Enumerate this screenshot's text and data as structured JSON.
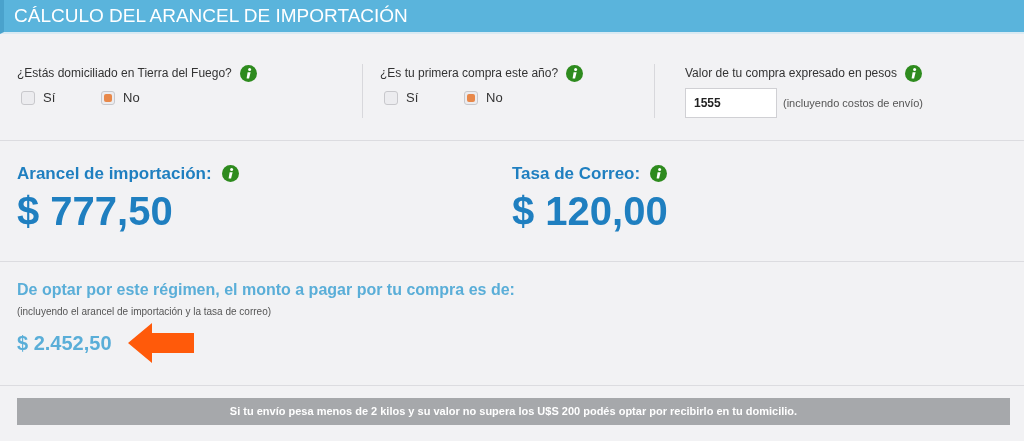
{
  "header": {
    "title": "CÁLCULO DEL ARANCEL DE IMPORTACIÓN"
  },
  "questions": [
    {
      "label": "¿Estás domiciliado en Tierra del Fuego?",
      "options": [
        {
          "label": "Sí",
          "selected": false
        },
        {
          "label": "No",
          "selected": true
        }
      ]
    },
    {
      "label": "¿Es tu primera compra este año?",
      "options": [
        {
          "label": "Sí",
          "selected": false
        },
        {
          "label": "No",
          "selected": true
        }
      ]
    }
  ],
  "purchase_value": {
    "label": "Valor de tu compra expresado en pesos",
    "value": "1555",
    "note": "(incluyendo costos de envío)"
  },
  "results": [
    {
      "label": "Arancel de importación:",
      "amount": "$ 777,50"
    },
    {
      "label": "Tasa de Correo:",
      "amount": "$ 120,00"
    }
  ],
  "total": {
    "heading": "De optar por este régimen, el monto a pagar por tu compra es de:",
    "note": "(incluyendo el arancel de importación y la tasa de correo)",
    "amount": "$ 2.452,50"
  },
  "footer_notice": "Si tu envío pesa menos de 2 kilos y su valor no supera los U$S 200 podés optar por recibirlo en tu domicilio."
}
